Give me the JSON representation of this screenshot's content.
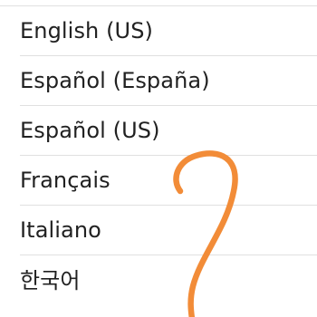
{
  "language_list": {
    "items": [
      {
        "label": "English (US)"
      },
      {
        "label": "Español (España)"
      },
      {
        "label": "Español (US)"
      },
      {
        "label": "Français"
      },
      {
        "label": "Italiano"
      },
      {
        "label": "한국어"
      }
    ]
  },
  "colors": {
    "text": "#212121",
    "divider": "#e0e0e0",
    "scribble": "#f28c38"
  }
}
